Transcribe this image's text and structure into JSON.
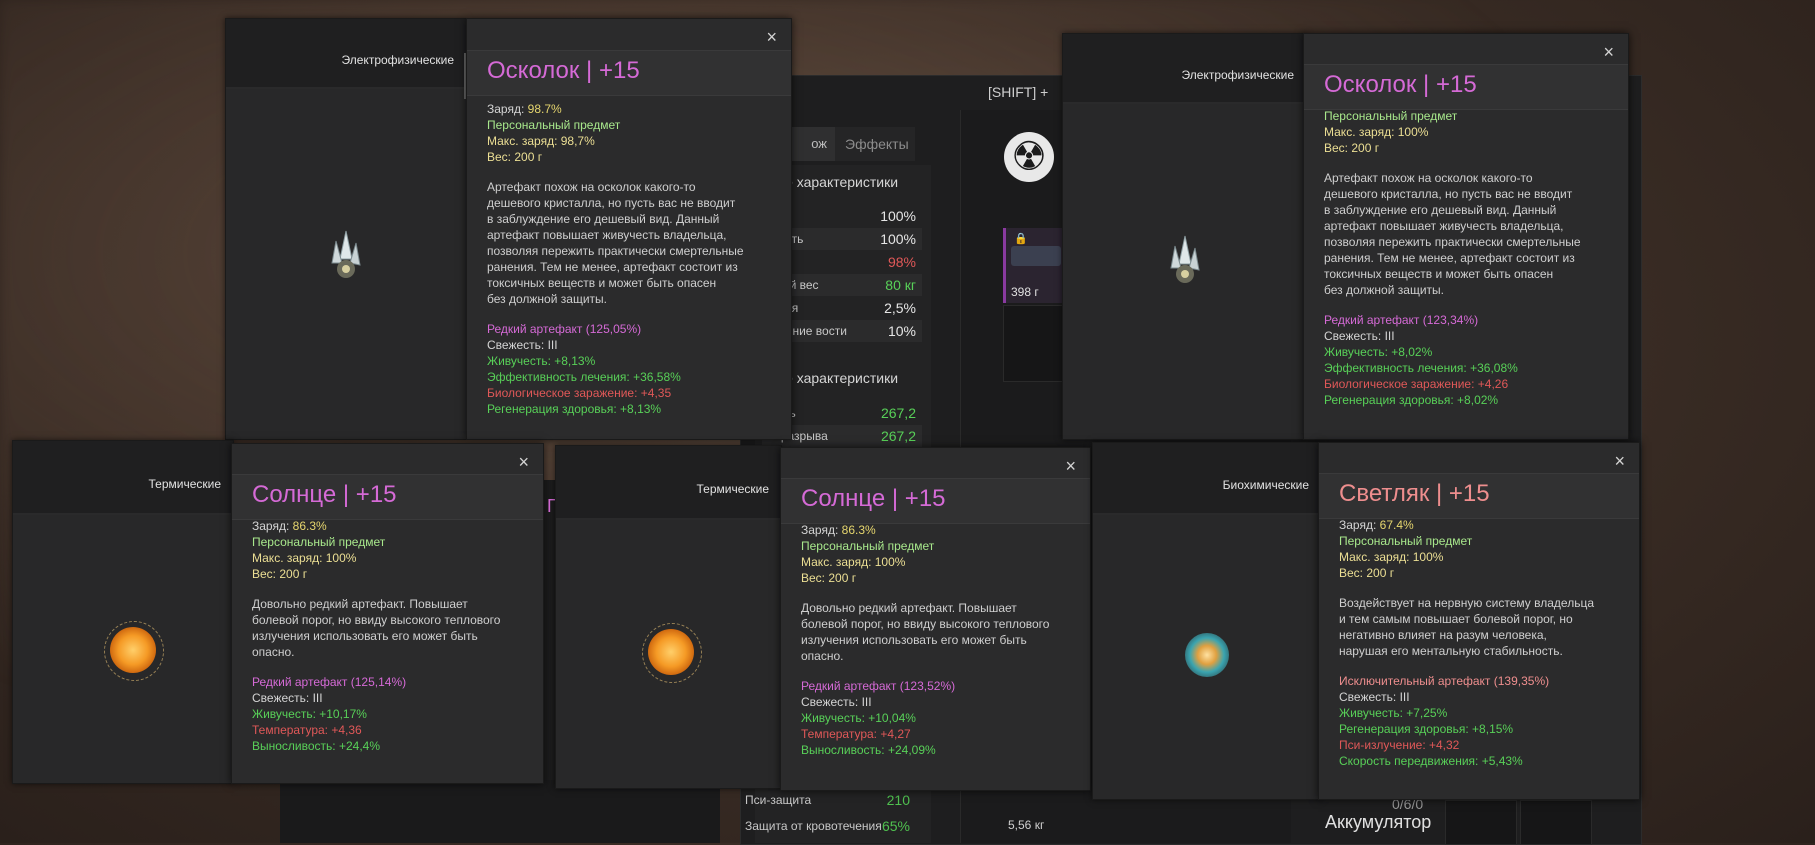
{
  "background": {
    "shift_hint": "[SHIFT] +",
    "tabs": [
      "ож",
      "Эффекты"
    ],
    "section1": "ые характеристики",
    "rows1": [
      {
        "k": "ость",
        "v": "100%"
      },
      {
        "k": "ивость",
        "v": "100%"
      },
      {
        "k": "ь",
        "v": "98%"
      },
      {
        "k": "имый вес",
        "v": "80 кг"
      },
      {
        "k": "зация",
        "v": "2,5%"
      },
      {
        "k": "овление вости",
        "v": "10%"
      }
    ],
    "section2": "ые характеристики",
    "rows2": [
      {
        "k": "кость",
        "v": "267,2"
      },
      {
        "k": "ст разрыва",
        "v": "267,2"
      }
    ],
    "bottom_rows": [
      {
        "k": "Пси-защита",
        "v": "210"
      },
      {
        "k": "Защита от кровотечения",
        "v": "65%"
      }
    ],
    "slot_weight": "398 г",
    "weight_total": "5,56 кг",
    "ratio": "0/6/0",
    "accumulator": "Аккумулятор",
    "partial_label": "Г"
  },
  "panes": [
    {
      "category": "Электрофизические",
      "title": "Осколок | +15",
      "charge_label": "Заряд:",
      "charge": "98.7%",
      "personal": "Персональный предмет",
      "max_charge": "Макс. заряд: 98,7%",
      "weight": "Вес: 200 г",
      "description": [
        "Артефакт похож на осколок какого-то",
        "дешевого кристалла, но пусть вас не вводит",
        "в заблуждение его дешевый вид. Данный",
        "артефакт повышает живучесть владельца,",
        "позволяя пережить практически смертельные",
        "ранения. Тем не менее, артефакт состоит из",
        "токсичных веществ и может быть опасен",
        "без должной защиты."
      ],
      "rarity": "Редкий артефакт (125,05%)",
      "freshness": "Свежесть: III",
      "stats": [
        {
          "text": "Живучесть: +8,13%",
          "kind": "good"
        },
        {
          "text": "Эффективность лечения: +36,58%",
          "kind": "good"
        },
        {
          "text": "Биологическое заражение: +4,35",
          "kind": "bad"
        },
        {
          "text": "Регенерация здоровья: +8,13%",
          "kind": "good"
        }
      ]
    },
    {
      "category": "Электрофизические",
      "title": "Осколок | +15",
      "personal": "Персональный предмет",
      "max_charge": "Макс. заряд: 100%",
      "weight": "Вес: 200 г",
      "description": [
        "Артефакт похож на осколок какого-то",
        "дешевого кристалла, но пусть вас не вводит",
        "в заблуждение его дешевый вид. Данный",
        "артефакт повышает живучесть владельца,",
        "позволяя пережить практически смертельные",
        "ранения. Тем не менее, артефакт состоит из",
        "токсичных веществ и может быть опасен",
        "без должной защиты."
      ],
      "rarity": "Редкий артефакт (123,34%)",
      "freshness": "Свежесть: III",
      "stats": [
        {
          "text": "Живучесть: +8,02%",
          "kind": "good"
        },
        {
          "text": "Эффективность лечения: +36,08%",
          "kind": "good"
        },
        {
          "text": "Биологическое заражение: +4,26",
          "kind": "bad"
        },
        {
          "text": "Регенерация здоровья: +8,02%",
          "kind": "good"
        }
      ]
    },
    {
      "category": "Термические",
      "title": "Солнце | +15",
      "charge_label": "Заряд:",
      "charge": "86.3%",
      "personal": "Персональный предмет",
      "max_charge": "Макс. заряд: 100%",
      "weight": "Вес: 200 г",
      "description": [
        "Довольно редкий артефакт. Повышает",
        "болевой порог, но ввиду высокого теплового",
        "излучения использовать его может быть",
        "опасно."
      ],
      "rarity": "Редкий артефакт (125,14%)",
      "freshness": "Свежесть: III",
      "stats": [
        {
          "text": "Живучесть: +10,17%",
          "kind": "good"
        },
        {
          "text": "Температура: +4,36",
          "kind": "bad"
        },
        {
          "text": "Выносливость: +24,4%",
          "kind": "good"
        }
      ]
    },
    {
      "category": "Термические",
      "title": "Солнце | +15",
      "charge_label": "Заряд:",
      "charge": "86.3%",
      "personal": "Персональный предмет",
      "max_charge": "Макс. заряд: 100%",
      "weight": "Вес: 200 г",
      "description": [
        "Довольно редкий артефакт. Повышает",
        "болевой порог, но ввиду высокого теплового",
        "излучения использовать его может быть",
        "опасно."
      ],
      "rarity": "Редкий артефакт (123,52%)",
      "freshness": "Свежесть: III",
      "stats": [
        {
          "text": "Живучесть: +10,04%",
          "kind": "good"
        },
        {
          "text": "Температура: +4,27",
          "kind": "bad"
        },
        {
          "text": "Выносливость: +24,09%",
          "kind": "good"
        }
      ]
    },
    {
      "category": "Биохимические",
      "title": "Светляк | +15",
      "charge_label": "Заряд:",
      "charge": "67.4%",
      "personal": "Персональный предмет",
      "max_charge": "Макс. заряд: 100%",
      "weight": "Вес: 200 г",
      "description": [
        "Воздействует на нервную систему владельца",
        "и тем самым повышает болевой порог, но",
        "негативно влияет на разум человека,",
        "нарушая его ментальную стабильность."
      ],
      "rarity": "Исключительный артефакт (139,35%)",
      "freshness": "Свежесть: III",
      "stats": [
        {
          "text": "Живучесть: +7,25%",
          "kind": "good"
        },
        {
          "text": "Регенерация здоровья: +8,15%",
          "kind": "good"
        },
        {
          "text": "Пси-излучение: +4,32",
          "kind": "bad"
        },
        {
          "text": "Скорость передвижения: +5,43%",
          "kind": "good"
        }
      ]
    }
  ],
  "close_glyph": "×",
  "icons": {
    "close": "close-icon",
    "radiation": "radiation-icon",
    "lock": "lock-icon"
  },
  "colors": {
    "title_purple": "#d56ad6",
    "title_salmon": "#ee8e8e",
    "good": "#58d058",
    "bad": "#e05858",
    "personal": "#a8e88c",
    "weight": "#ecdf94"
  }
}
